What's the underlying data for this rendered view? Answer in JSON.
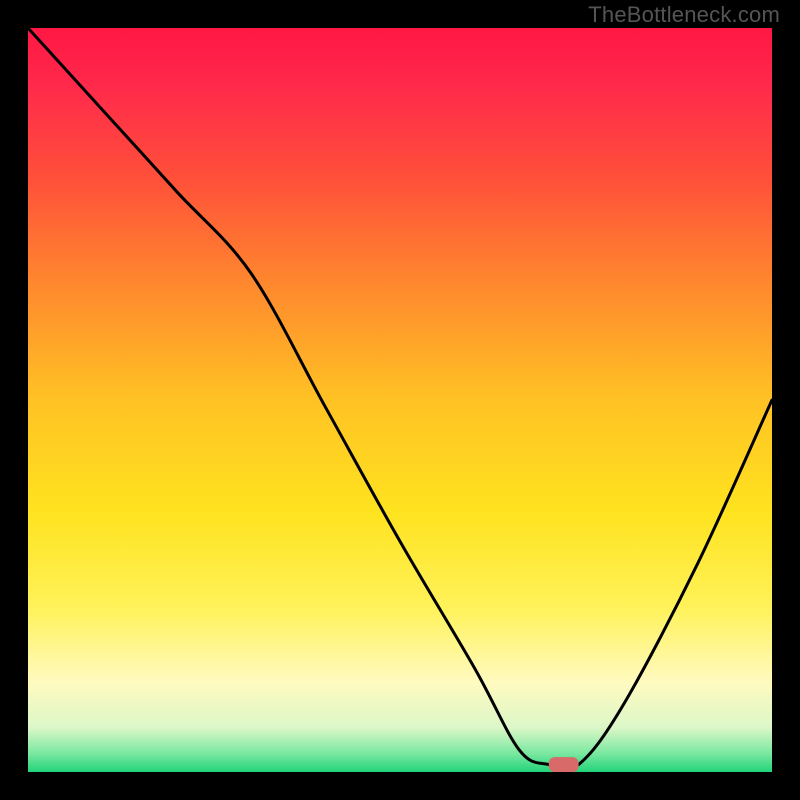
{
  "watermark": "TheBottleneck.com",
  "chart_data": {
    "type": "line",
    "title": "",
    "xlabel": "",
    "ylabel": "",
    "xlim": [
      0,
      100
    ],
    "ylim": [
      0,
      100
    ],
    "x": [
      0,
      10,
      20,
      30,
      40,
      50,
      60,
      66,
      70,
      74,
      80,
      90,
      100
    ],
    "values": [
      100,
      89,
      78,
      67,
      49,
      31,
      14,
      3,
      1,
      1,
      9,
      28,
      50
    ],
    "marker": {
      "x": 72,
      "y": 1,
      "width": 4,
      "height": 2
    },
    "gradient_stops": [
      {
        "offset": 0.0,
        "color": "#ff1744"
      },
      {
        "offset": 0.08,
        "color": "#ff2a4b"
      },
      {
        "offset": 0.2,
        "color": "#ff4f3a"
      },
      {
        "offset": 0.35,
        "color": "#ff8a2d"
      },
      {
        "offset": 0.5,
        "color": "#ffc224"
      },
      {
        "offset": 0.65,
        "color": "#ffe31f"
      },
      {
        "offset": 0.78,
        "color": "#fff25a"
      },
      {
        "offset": 0.88,
        "color": "#fffac0"
      },
      {
        "offset": 0.94,
        "color": "#dcf7c8"
      },
      {
        "offset": 0.975,
        "color": "#7ae8a0"
      },
      {
        "offset": 1.0,
        "color": "#22d37a"
      }
    ]
  }
}
